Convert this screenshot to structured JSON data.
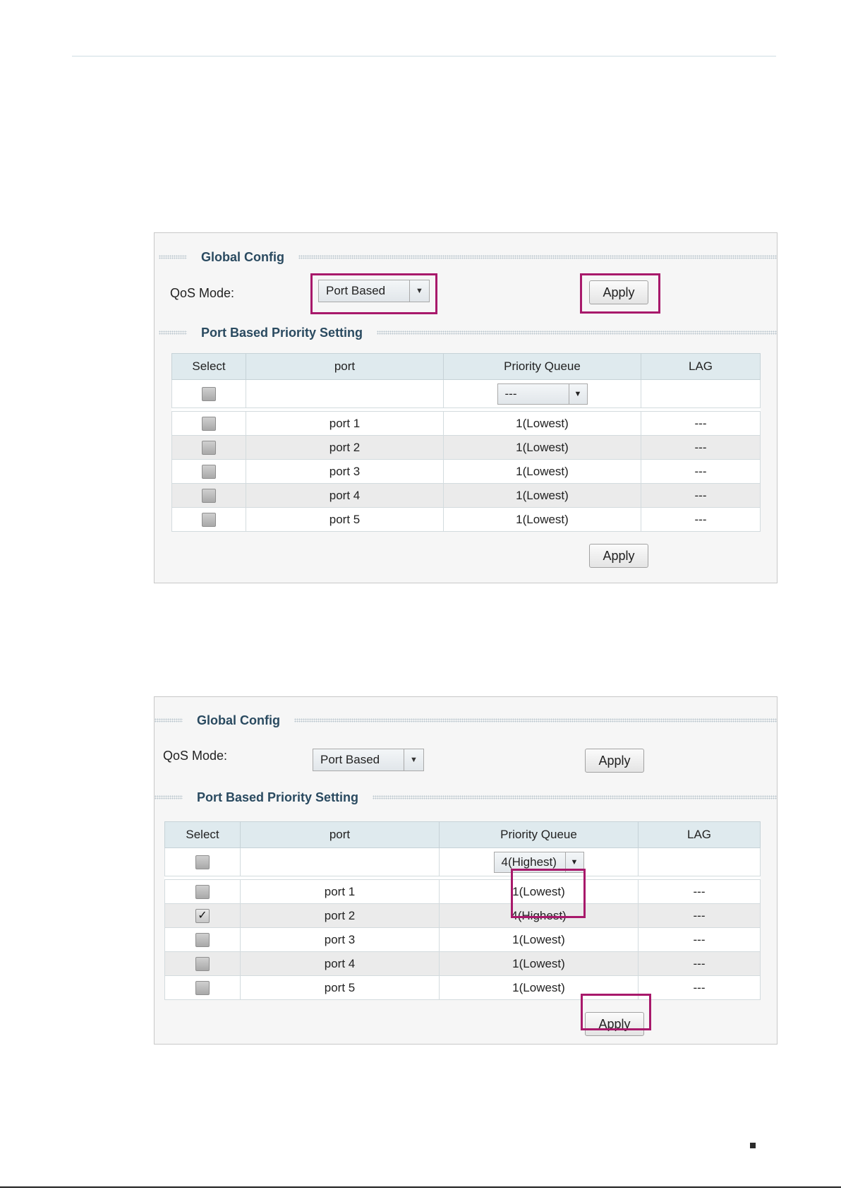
{
  "icons": {
    "dropdown_arrow": "triangle-down-icon",
    "checkmark": "checkmark-icon"
  },
  "colors": {
    "highlight": "#a8196b",
    "section_title": "#2a4a60",
    "header_bg": "#dfeaee"
  },
  "panel1": {
    "global_config_title": "Global Config",
    "qos_mode_label": "QoS Mode:",
    "qos_mode_value": "Port Based",
    "apply_label": "Apply",
    "port_section_title": "Port Based Priority Setting",
    "table_headers": {
      "select": "Select",
      "port": "port",
      "priority_queue": "Priority Queue",
      "lag": "LAG"
    },
    "filter_priority_value": "---",
    "rows": [
      {
        "port": "port 1",
        "priority": "1(Lowest)",
        "lag": "---",
        "checked": false
      },
      {
        "port": "port 2",
        "priority": "1(Lowest)",
        "lag": "---",
        "checked": false
      },
      {
        "port": "port 3",
        "priority": "1(Lowest)",
        "lag": "---",
        "checked": false
      },
      {
        "port": "port 4",
        "priority": "1(Lowest)",
        "lag": "---",
        "checked": false
      },
      {
        "port": "port 5",
        "priority": "1(Lowest)",
        "lag": "---",
        "checked": false
      }
    ],
    "bottom_apply_label": "Apply"
  },
  "panel2": {
    "global_config_title": "Global Config",
    "qos_mode_label": "QoS Mode:",
    "qos_mode_value": "Port Based",
    "apply_label": "Apply",
    "port_section_title": "Port Based Priority Setting",
    "table_headers": {
      "select": "Select",
      "port": "port",
      "priority_queue": "Priority Queue",
      "lag": "LAG"
    },
    "filter_priority_value": "4(Highest)",
    "rows": [
      {
        "port": "port 1",
        "priority": "1(Lowest)",
        "lag": "---",
        "checked": false
      },
      {
        "port": "port 2",
        "priority": "4(Highest)",
        "lag": "---",
        "checked": true,
        "check_mark": "✓"
      },
      {
        "port": "port 3",
        "priority": "1(Lowest)",
        "lag": "---",
        "checked": false
      },
      {
        "port": "port 4",
        "priority": "1(Lowest)",
        "lag": "---",
        "checked": false
      },
      {
        "port": "port 5",
        "priority": "1(Lowest)",
        "lag": "---",
        "checked": false
      }
    ],
    "bottom_apply_label": "Apply"
  }
}
